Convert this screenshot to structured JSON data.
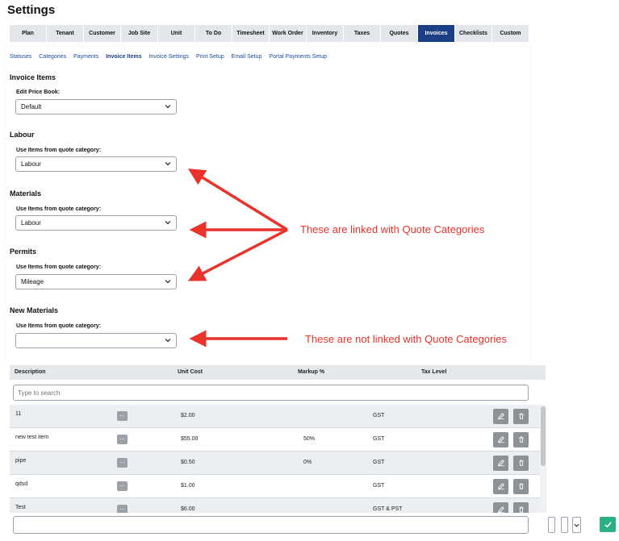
{
  "page": {
    "title": "Settings"
  },
  "main_tabs": [
    "Plan",
    "Tenant",
    "Customer",
    "Job Site",
    "Unit",
    "To Do",
    "Timesheet",
    "Work Order",
    "Inventory",
    "Taxes",
    "Quotes",
    "Invoices",
    "Checklists",
    "Custom"
  ],
  "active_main_tab": "Invoices",
  "sub_tabs": [
    "Statuses",
    "Categories",
    "Payments",
    "Invoice Items",
    "Invoice Settings",
    "Print Setup",
    "Email Setup",
    "Portal Payments Setup"
  ],
  "active_sub_tab": "Invoice Items",
  "invoice_items": {
    "heading": "Invoice Items",
    "price_book_label": "Edit Price Book:",
    "price_book_value": "Default"
  },
  "category_sections": [
    {
      "heading": "Labour",
      "label": "Use Items from quote category:",
      "value": "Labour"
    },
    {
      "heading": "Materials",
      "label": "Use Items from quote category:",
      "value": "Labour"
    },
    {
      "heading": "Permits",
      "label": "Use Items from quote category:",
      "value": "Mileage"
    },
    {
      "heading": "New Materials",
      "label": "Use Items from quote category:",
      "value": ""
    }
  ],
  "annotations": {
    "linked": "These are linked with Quote Categories",
    "not_linked": "These are not linked with Quote Categories",
    "color": "#e8322a"
  },
  "table": {
    "columns": [
      "Description",
      "Unit Cost",
      "Markup %",
      "Tax Level"
    ],
    "search_placeholder": "Type to search",
    "more_label": "...",
    "rows": [
      {
        "description": "11",
        "unit_cost": "$2.00",
        "markup": "",
        "tax": "GST"
      },
      {
        "description": "new test item",
        "unit_cost": "$55.00",
        "markup": "50%",
        "tax": "GST"
      },
      {
        "description": "pipe",
        "unit_cost": "$0.50",
        "markup": "0%",
        "tax": "GST"
      },
      {
        "description": "qdsd",
        "unit_cost": "$1.00",
        "markup": "",
        "tax": "GST"
      },
      {
        "description": "Test",
        "unit_cost": "$6.00",
        "markup": "",
        "tax": "GST & PST"
      }
    ]
  },
  "colors": {
    "active_tab": "#1b3f87",
    "link": "#1a4ea0",
    "confirm": "#2bb084"
  },
  "icons": [
    "chevron-down-icon",
    "edit-icon",
    "trash-icon",
    "check-icon"
  ]
}
